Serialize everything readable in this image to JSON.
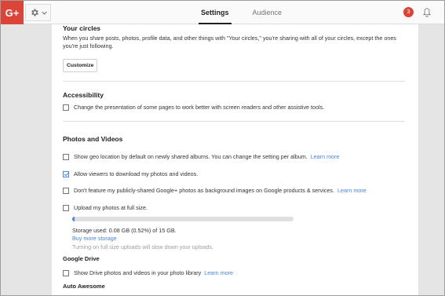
{
  "app": {
    "logo": "G+"
  },
  "header": {
    "tabs": [
      {
        "label": "Settings",
        "active": true
      },
      {
        "label": "Audience",
        "active": false
      }
    ],
    "notification_count": "3"
  },
  "circles": {
    "heading": "Your circles",
    "description": "When you share posts, photos, profile data, and other things with \"Your circles,\" you're sharing with all of your circles, except the ones you're just following.",
    "customize_label": "Customize"
  },
  "accessibility": {
    "heading": "Accessibility",
    "option": {
      "label": "Change the presentation of some pages to work better with screen readers and other assistive tools.",
      "checked": false
    }
  },
  "photos": {
    "heading": "Photos and Videos",
    "geo": {
      "label": "Show geo location by default on newly shared albums. You can change the setting per album.",
      "link": "Learn more",
      "checked": false
    },
    "download": {
      "label": "Allow viewers to download my photos and videos.",
      "checked": true
    },
    "background": {
      "label": "Don't feature my publicly-shared Google+ photos as background images on Google products & services.",
      "link": "Learn more",
      "checked": false
    },
    "fullsize": {
      "label": "Upload my photos at full size.",
      "checked": false
    },
    "storage": {
      "used_fraction": 0.0052,
      "text": "Storage used: 0.08 GB (0.52%) of 15 GB.",
      "buy_link": "Buy more storage",
      "note": "Turning on full size uploads will slow down your uploads."
    }
  },
  "drive": {
    "heading": "Google Drive",
    "option": {
      "label": "Show Drive photos and videos in your photo library",
      "link": "Learn more",
      "checked": false
    }
  },
  "auto_awesome": {
    "heading": "Auto Awesome"
  },
  "colors": {
    "accent": "#4285f4",
    "brand": "#db4437"
  }
}
